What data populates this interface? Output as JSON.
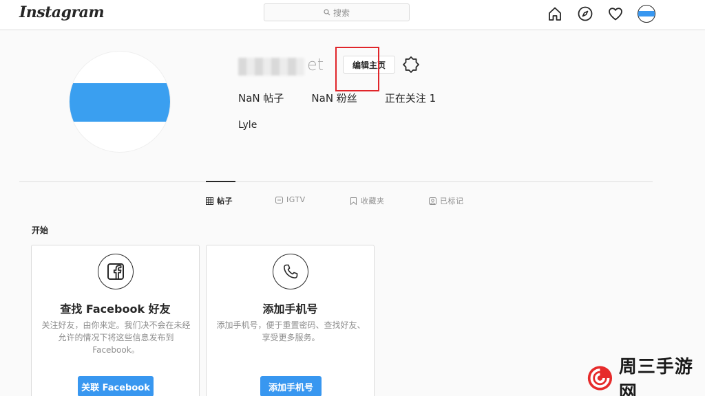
{
  "topnav": {
    "logo": "Instagram",
    "search_placeholder": "搜索",
    "icons": [
      "home-icon",
      "explore-compass-icon",
      "activity-heart-icon",
      "profile-avatar"
    ]
  },
  "profile": {
    "username_tail": "et",
    "edit_button": "编辑主页",
    "stats": {
      "posts": "NaN 帖子",
      "followers": "NaN 粉丝",
      "following": "正在关注 1"
    },
    "full_name": "Lyle"
  },
  "tabs": [
    {
      "label": "帖子",
      "icon": "grid-icon"
    },
    {
      "label": "IGTV",
      "icon": "igtv-icon"
    },
    {
      "label": "收藏夹",
      "icon": "bookmark-icon"
    },
    {
      "label": "已标记",
      "icon": "tagged-icon"
    }
  ],
  "section_title": "开始",
  "cards": [
    {
      "icon": "facebook-icon",
      "title": "查找 Facebook 好友",
      "description": "关注好友，由你来定。我们决不会在未经允许的情况下将这些信息发布到 Facebook。",
      "button": "关联 Facebook"
    },
    {
      "icon": "phone-icon",
      "title": "添加手机号",
      "description": "添加手机号，便于重置密码、查找好友、享受更多服务。",
      "button": "添加手机号"
    }
  ],
  "watermark": {
    "text": "周三手游网"
  },
  "colors": {
    "accent_blue": "#3897f0",
    "highlight_red": "#e0252a",
    "border": "#dbdbdb",
    "background": "#fafafa"
  }
}
